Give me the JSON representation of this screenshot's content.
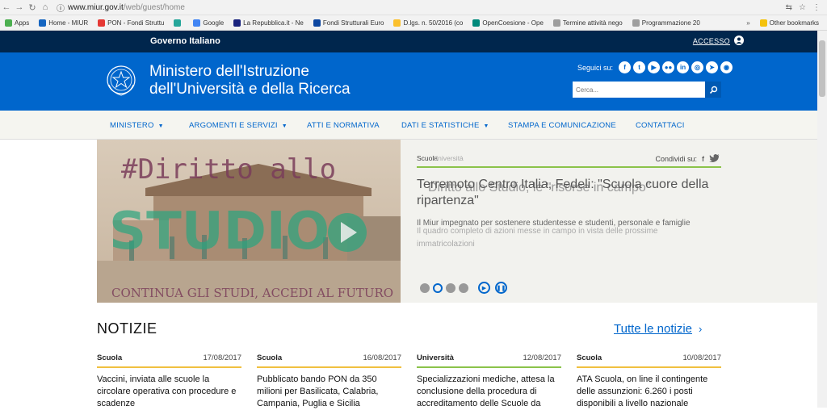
{
  "browser": {
    "url_host": "www.miur.gov.it",
    "url_path": "/web/guest/home",
    "bookmarks": [
      {
        "label": "Apps",
        "color": "#4caf50"
      },
      {
        "label": "Home - MIUR",
        "color": "#1565c0"
      },
      {
        "label": "PON - Fondi Struttu",
        "color": "#e53935"
      },
      {
        "label": "",
        "color": "#26a69a"
      },
      {
        "label": "Google",
        "color": "#4285f4"
      },
      {
        "label": "La Repubblica.it - Ne",
        "color": "#1a237e"
      },
      {
        "label": "Fondi Strutturali Euro",
        "color": "#0d47a1"
      },
      {
        "label": "D.lgs. n. 50/2016 (co",
        "color": "#fbc02d"
      },
      {
        "label": "OpenCoesione - Ope",
        "color": "#00897b"
      },
      {
        "label": "Termine attività nego",
        "color": "#9e9e9e"
      },
      {
        "label": "Programmazione 20",
        "color": "#9e9e9e"
      }
    ],
    "bookmarks_more": "»",
    "other_bookmarks": "Other bookmarks"
  },
  "gov_bar": {
    "title": "Governo Italiano",
    "login": "ACCESSO"
  },
  "header": {
    "site_name_line1": "Ministero dell'Istruzione",
    "site_name_line2": "dell'Università e della Ricerca",
    "follow_label": "Seguici su:",
    "social": [
      "f",
      "t",
      "▶",
      "●●",
      "in",
      "◎",
      "➤",
      "◉"
    ],
    "search_placeholder": "Cerca..."
  },
  "menu": [
    {
      "label": "MINISTERO",
      "caret": true
    },
    {
      "label": "ARGOMENTI E SERVIZI",
      "caret": true
    },
    {
      "label": "ATTI E NORMATIVA",
      "caret": false
    },
    {
      "label": "DATI E STATISTICHE",
      "caret": true
    },
    {
      "label": "STAMPA E COMUNICAZIONE",
      "caret": false
    },
    {
      "label": "CONTATTACI",
      "caret": false
    }
  ],
  "hero": {
    "image_title": "#Diritto allo",
    "image_word": "STUDIO",
    "image_caption": "CONTINUA GLI STUDI, ACCEDI AL FUTURO",
    "category": "Scuola",
    "category_ghost": "Università",
    "share_label": "Condividi su:",
    "title": "Terremoto Centro Italia, Fedeli: \"Scuola cuore della ripartenza\"",
    "title_ghost": "Diritto allo Studio, le \"risorse in campo\"",
    "text": "Il Miur impegnato per sostenere studentesse e studenti, personale e famiglie",
    "text_ghost": "Il quadro completo di azioni messe in campo in vista delle prossime immatricolazioni"
  },
  "news": {
    "title": "NOTIZIE",
    "all_label": "Tutte le notizie",
    "items": [
      {
        "category": "Scuola",
        "date": "17/08/2017",
        "headline": "Vaccini, inviata alle scuole la circolare operativa con procedure e scadenze",
        "accent": "#f0c040"
      },
      {
        "category": "Scuola",
        "date": "16/08/2017",
        "headline": "Pubblicato bando PON da 350 milioni per Basilicata, Calabria, Campania, Puglia e Sicilia",
        "accent": "#f0c040"
      },
      {
        "category": "Università",
        "date": "12/08/2017",
        "headline": "Specializzazioni mediche, attesa la conclusione della procedura di accreditamento delle Scuole da",
        "accent": "#8bc34a"
      },
      {
        "category": "Scuola",
        "date": "10/08/2017",
        "headline": "ATA Scuola, on line il contingente delle assunzioni: 6.260 i posti disponibili a livello nazionale",
        "accent": "#f0c040"
      }
    ]
  },
  "colors": {
    "navy": "#00264d",
    "blue": "#0066cc",
    "green": "#8bc34a",
    "yellow": "#f0c040"
  }
}
